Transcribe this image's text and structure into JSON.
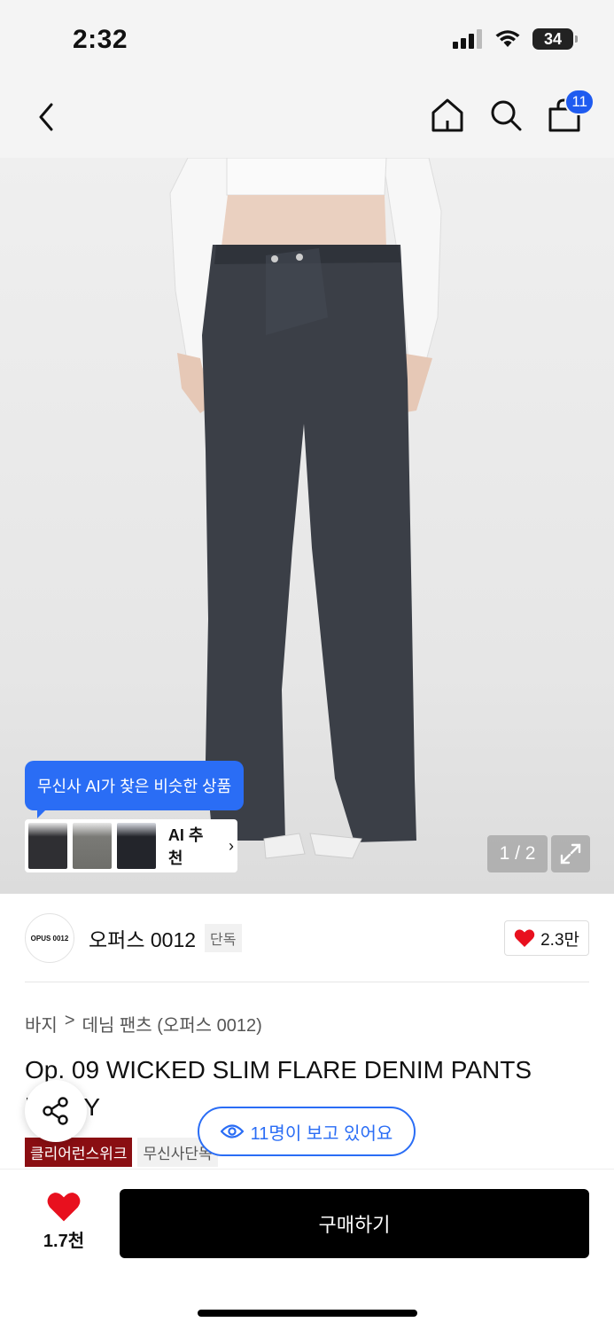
{
  "status": {
    "time": "2:32",
    "battery": "34"
  },
  "nav": {
    "cart_count": "11"
  },
  "gallery": {
    "ai_tooltip": "무신사 AI가 찾은 비슷한 상품",
    "ai_label": "AI 추천",
    "counter": "1 / 2"
  },
  "brand": {
    "logo_text": "OPUS 0012",
    "name": "오퍼스 0012",
    "exclusive": "단독",
    "likes": "2.3만"
  },
  "breadcrumb": {
    "category": "바지",
    "separator": ">",
    "subcategory": "데님 팬츠 (오퍼스 0012)"
  },
  "product": {
    "title": "Op. 09 WICKED SLIM FLARE DENIM PANTS [GRAY"
  },
  "tags": [
    "클리어런스위크",
    "무신사단독"
  ],
  "viewers": "11명이 보고 있어요",
  "bottom": {
    "wish_count": "1.7천",
    "buy_label": "구매하기"
  },
  "colors": {
    "accent": "#2a6df5",
    "badge": "#1f5bf0",
    "tag_red": "#8a0e12",
    "heart": "#e8101e"
  }
}
